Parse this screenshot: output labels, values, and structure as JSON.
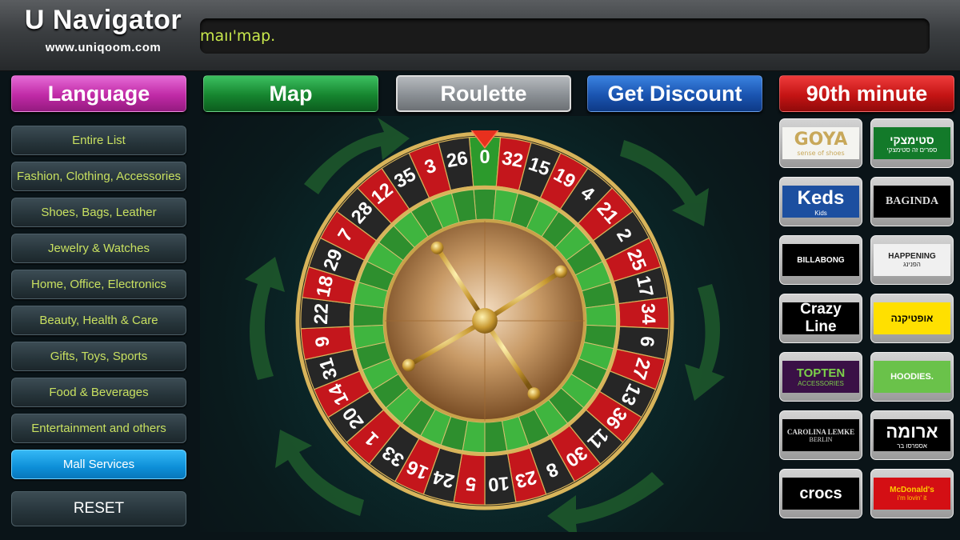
{
  "header": {
    "brand_title": "U Navigator",
    "brand_url": "www.uniqoom.com",
    "ticker_text": "maıı'map."
  },
  "topbar": {
    "language": "Language",
    "map": "Map",
    "roulette": "Roulette",
    "discount": "Get Discount",
    "minute90": "90th minute"
  },
  "sidebar": {
    "items": [
      {
        "label": "Entire List"
      },
      {
        "label": "Fashion, Clothing, Accessories"
      },
      {
        "label": "Shoes, Bags, Leather"
      },
      {
        "label": "Jewelry & Watches"
      },
      {
        "label": "Home, Office, Electronics"
      },
      {
        "label": "Beauty, Health & Care"
      },
      {
        "label": "Gifts, Toys, Sports"
      },
      {
        "label": "Food & Beverages"
      },
      {
        "label": "Entertainment and others"
      },
      {
        "label": "Mall Services"
      }
    ],
    "active_index": 9,
    "reset": "RESET"
  },
  "roulette": {
    "numbers": [
      "0",
      "32",
      "15",
      "19",
      "4",
      "21",
      "2",
      "25",
      "17",
      "34",
      "6",
      "27",
      "13",
      "36",
      "11",
      "30",
      "8",
      "23",
      "10",
      "5",
      "24",
      "16",
      "33",
      "1",
      "20",
      "14",
      "31",
      "9",
      "22",
      "18",
      "29",
      "7",
      "28",
      "12",
      "35",
      "3",
      "26"
    ],
    "colors": {
      "red": "#c4161c",
      "black": "#262626",
      "green": "#2c9a2c",
      "rim": "#c9a24a"
    }
  },
  "stores": [
    {
      "name": "GOYA",
      "sub": "sense of shoes",
      "icon": "goya-logo"
    },
    {
      "name": "סטימצקי",
      "sub": "ספרים זה סטימצקי",
      "icon": "steimatzky-logo"
    },
    {
      "name": "Keds",
      "sub": "Kids",
      "icon": "keds-logo"
    },
    {
      "name": "BAGINDA",
      "sub": "",
      "icon": "baginda-logo"
    },
    {
      "name": "BILLABONG",
      "sub": "",
      "icon": "billabong-logo"
    },
    {
      "name": "HAPPENING",
      "sub": "הפנינג",
      "icon": "happening-logo"
    },
    {
      "name": "Crazy Line",
      "sub": "",
      "icon": "crazy-line-logo"
    },
    {
      "name": "אופטיקנה",
      "sub": "",
      "icon": "optikana-logo"
    },
    {
      "name": "TOPTEN",
      "sub": "ACCESSORIES",
      "icon": "topten-logo"
    },
    {
      "name": "HOODIES.",
      "sub": "",
      "icon": "hoodies-logo"
    },
    {
      "name": "CAROLINA LEMKE",
      "sub": "BERLIN",
      "icon": "carolina-lemke-logo"
    },
    {
      "name": "ארומה",
      "sub": "אספרסו בר",
      "icon": "aroma-logo"
    },
    {
      "name": "crocs",
      "sub": "",
      "icon": "crocs-logo"
    },
    {
      "name": "McDonald's",
      "sub": "i'm lovin' it",
      "icon": "mcdonalds-logo"
    }
  ]
}
